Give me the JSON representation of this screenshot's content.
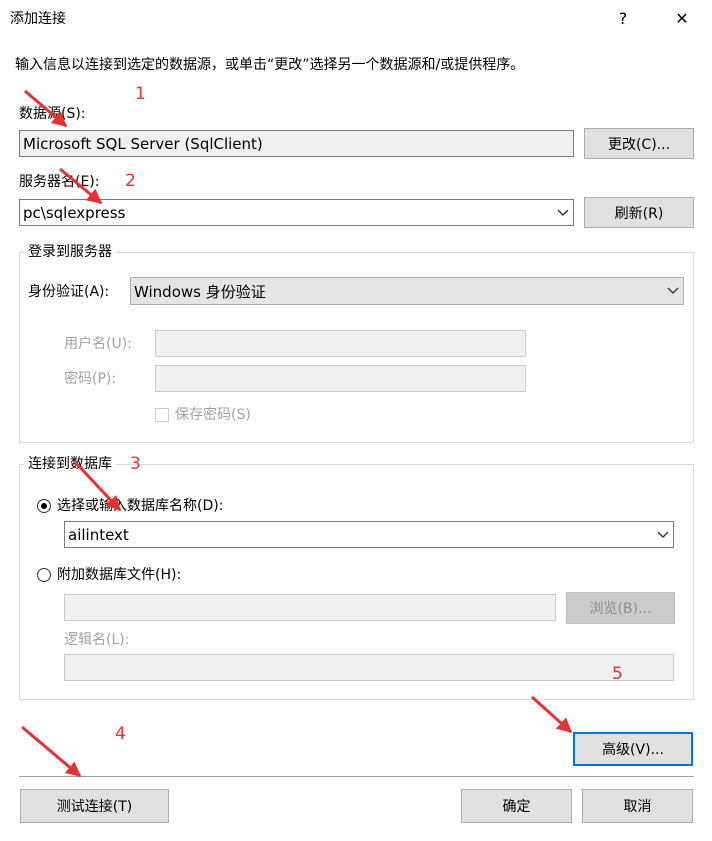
{
  "window": {
    "title": "添加连接",
    "help_glyph": "?",
    "close_glyph": "✕"
  },
  "intro": "输入信息以连接到选定的数据源，或单击“更改”选择另一个数据源和/或提供程序。",
  "data_source": {
    "label": "数据源(S):",
    "value": "Microsoft SQL Server (SqlClient)",
    "change_button": "更改(C)..."
  },
  "server": {
    "label": "服务器名(E):",
    "value": "pc\\sqlexpress",
    "refresh_button": "刷新(R)"
  },
  "login": {
    "group_title": "登录到服务器",
    "auth_label": "身份验证(A):",
    "auth_value": "Windows 身份验证",
    "username_label": "用户名(U):",
    "username_value": "",
    "password_label": "密码(P):",
    "password_value": "",
    "save_password_label": "保存密码(S)"
  },
  "database": {
    "group_title": "连接到数据库",
    "select_option_label": "选择或输入数据库名称(D):",
    "db_name_value": "ailintext",
    "attach_option_label": "附加数据库文件(H):",
    "attach_value": "",
    "browse_button": "浏览(B)...",
    "logical_name_label": "逻辑名(L):",
    "logical_name_value": ""
  },
  "buttons": {
    "advanced": "高级(V)...",
    "test": "测试连接(T)",
    "ok": "确定",
    "cancel": "取消"
  },
  "annotations": {
    "a1": "1",
    "a2": "2",
    "a3": "3",
    "a4": "4",
    "a5": "5"
  },
  "colors": {
    "annotation": "#e53333",
    "focus_border": "#0078d7",
    "button_face": "#e1e1e1"
  }
}
